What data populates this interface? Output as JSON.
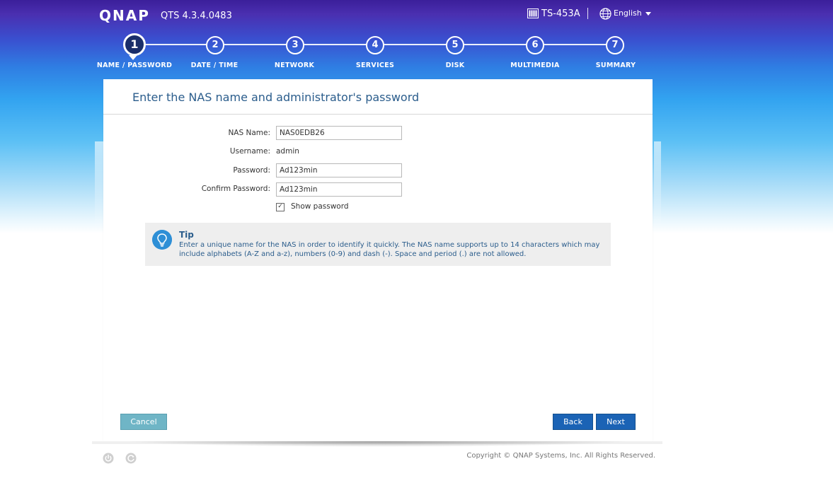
{
  "header": {
    "logo": "QNAP",
    "version": "QTS 4.3.4.0483",
    "device_name": "TS-453A",
    "language": "English"
  },
  "steps": [
    {
      "number": "1",
      "label": "NAME / PASSWORD",
      "active": true
    },
    {
      "number": "2",
      "label": "DATE / TIME",
      "active": false
    },
    {
      "number": "3",
      "label": "NETWORK",
      "active": false
    },
    {
      "number": "4",
      "label": "SERVICES",
      "active": false
    },
    {
      "number": "5",
      "label": "DISK",
      "active": false
    },
    {
      "number": "6",
      "label": "MULTIMEDIA",
      "active": false
    },
    {
      "number": "7",
      "label": "SUMMARY",
      "active": false
    }
  ],
  "panel": {
    "title": "Enter the NAS name and administrator's password"
  },
  "form": {
    "nas_name_label": "NAS Name:",
    "nas_name_value": "NAS0EDB26",
    "username_label": "Username:",
    "username_value": "admin",
    "password_label": "Password:",
    "password_value": "Ad123min",
    "confirm_label": "Confirm Password:",
    "confirm_value": "Ad123min",
    "show_password_label": "Show password",
    "show_password_checked": true
  },
  "tip": {
    "title": "Tip",
    "text": "Enter a unique name for the NAS in order to identify it quickly. The NAS name supports up to 14 characters which may include alphabets (A-Z and a-z), numbers (0-9) and dash (-). Space and period (.) are not allowed."
  },
  "buttons": {
    "cancel": "Cancel",
    "back": "Back",
    "next": "Next"
  },
  "footer": {
    "copyright": "Copyright © QNAP Systems, Inc. All Rights Reserved."
  },
  "icons": {
    "device": "nas-device-icon",
    "language": "globe-icon",
    "tip": "lightbulb-icon",
    "footer_left": "power-icon",
    "footer_right": "restart-icon"
  },
  "colors": {
    "header_top": "#3b1f9a",
    "header_mid": "#32a3f0",
    "title": "#2b5d8c",
    "primary_button": "#1b63b5",
    "cancel_button": "#6fb5c6",
    "tip_icon": "#2e8fd6"
  }
}
